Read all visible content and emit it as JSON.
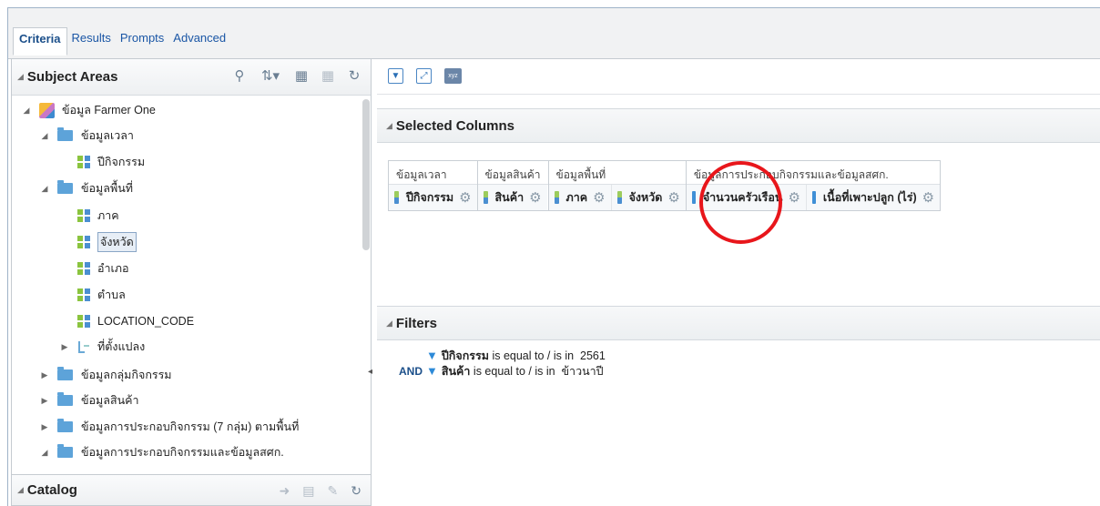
{
  "tabs": [
    "Criteria",
    "Results",
    "Prompts",
    "Advanced"
  ],
  "subject_areas": {
    "title": "Subject Areas",
    "tools": [
      "search-icon",
      "sort-icon",
      "add-icon",
      "remove-icon",
      "refresh-icon"
    ],
    "tree": [
      {
        "label": "ข้อมูล Farmer One",
        "level": 0,
        "expanded": true,
        "type": "subject-area"
      },
      {
        "label": "ข้อมูลเวลา",
        "level": 1,
        "expanded": true,
        "type": "folder"
      },
      {
        "label": "ปีกิจกรรม",
        "level": 2,
        "type": "column"
      },
      {
        "label": "ข้อมูลพื้นที่",
        "level": 1,
        "expanded": true,
        "type": "folder"
      },
      {
        "label": "ภาค",
        "level": 2,
        "type": "column"
      },
      {
        "label": "จังหวัด",
        "level": 2,
        "type": "column",
        "selected": true
      },
      {
        "label": "อำเภอ",
        "level": 2,
        "type": "column"
      },
      {
        "label": "ตำบล",
        "level": 2,
        "type": "column"
      },
      {
        "label": "LOCATION_CODE",
        "level": 2,
        "type": "column"
      },
      {
        "label": "ที่ตั้งแปลง",
        "level": 2,
        "expanded": false,
        "type": "hierarchy"
      },
      {
        "label": "ข้อมูลกลุ่มกิจกรรม",
        "level": 1,
        "expanded": false,
        "type": "folder"
      },
      {
        "label": "ข้อมูลสินค้า",
        "level": 1,
        "expanded": false,
        "type": "folder"
      },
      {
        "label": "ข้อมูลการประกอบกิจกรรม (7 กลุ่ม) ตามพื้นที่",
        "level": 1,
        "expanded": false,
        "type": "folder"
      },
      {
        "label": "ข้อมูลการประกอบกิจกรรมและข้อมูลสศก.",
        "level": 1,
        "expanded": true,
        "type": "folder"
      }
    ]
  },
  "catalog": {
    "title": "Catalog"
  },
  "selected_columns": {
    "title": "Selected Columns",
    "groups": [
      {
        "name": "ข้อมูลเวลา",
        "columns": [
          "ปีกิจกรรม"
        ]
      },
      {
        "name": "ข้อมูลสินค้า",
        "columns": [
          "สินค้า"
        ]
      },
      {
        "name": "ข้อมูลพื้นที่",
        "columns": [
          "ภาค",
          "จังหวัด"
        ]
      },
      {
        "name": "ข้อมูลการประกอบกิจกรรมและข้อมูลสศก.",
        "columns": [
          "จำนวนครัวเรือน",
          "เนื้อที่เพาะปลูก (ไร่)"
        ]
      }
    ]
  },
  "filters": {
    "title": "Filters",
    "items": [
      {
        "connector": "",
        "column": "ปีกิจกรรม",
        "operator": "is equal to / is in",
        "value": "2561"
      },
      {
        "connector": "AND",
        "column": "สินค้า",
        "operator": "is equal to / is in",
        "value": "ข้าวนาปี"
      }
    ]
  },
  "colors": {
    "accent": "#1b4f8a",
    "highlight_circle": "#e8161b"
  }
}
